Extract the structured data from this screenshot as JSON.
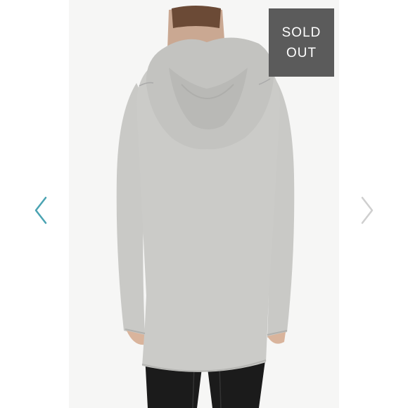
{
  "gallery": {
    "badge": {
      "line1": "SOLD",
      "line2": "OUT",
      "background": "#5b5b5b",
      "text_color": "#ffffff"
    },
    "prev_arrow": {
      "icon": "chevron-left-icon",
      "color": "#4aa3b2"
    },
    "next_arrow": {
      "icon": "chevron-right-icon",
      "color": "#cfcfcf"
    },
    "photo": {
      "subject": "model-back-view",
      "garment_color": "#cbcbc8"
    }
  }
}
